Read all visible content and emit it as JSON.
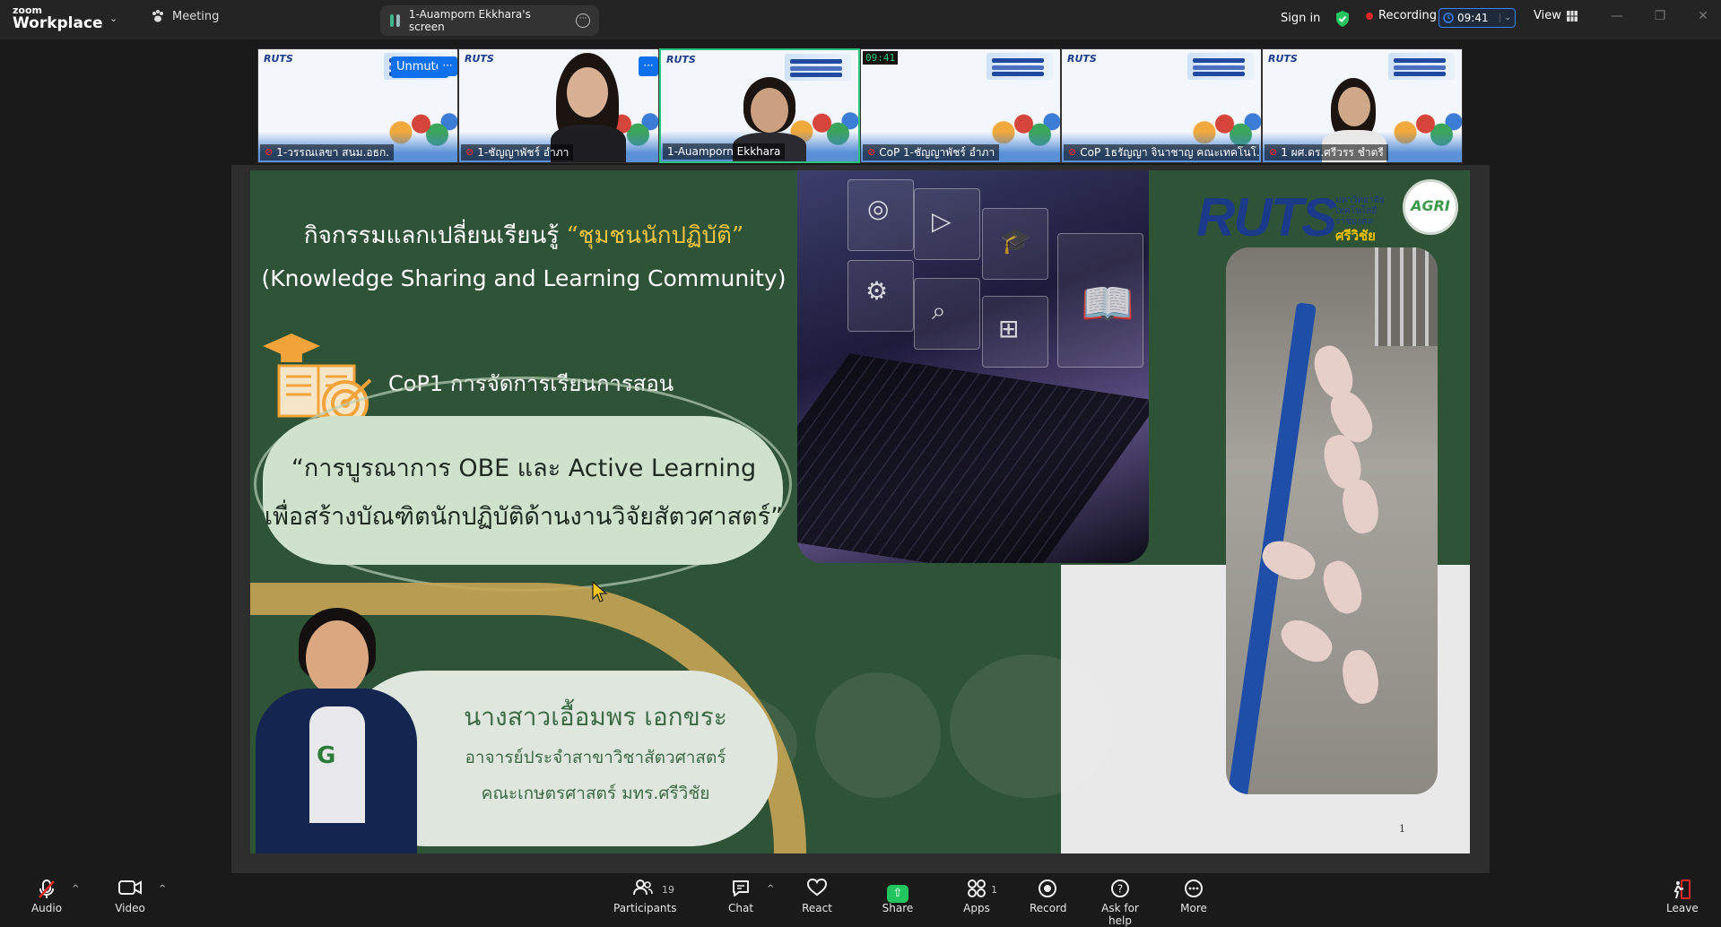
{
  "titlebar": {
    "brand_small": "zoom",
    "brand_large": "Workplace",
    "meeting_tab": "Meeting",
    "share_tab": "1-Auamporn Ekkhara's screen",
    "sign_in": "Sign in",
    "recording": "Recording",
    "timer": "09:41",
    "view": "View"
  },
  "filmstrip": {
    "tiles": [
      {
        "name": "1-วรรณเลขา  สนม.อธก.",
        "logo": "RUTS",
        "unmute": "Unmute",
        "muted": true
      },
      {
        "name": "1-ชัญญาพัชร์ อำภา",
        "logo": "RUTS",
        "muted": true
      },
      {
        "name": "1-Auamporn Ekkhara",
        "logo": "RUTS",
        "muted": false
      },
      {
        "name": "CoP 1-ชัญญาพัชร์ อำภา",
        "logo": "",
        "timer": "09:41",
        "muted": true
      },
      {
        "name": "CoP 1ธรัญญา จินาชาญ คณะเทคโนโ...",
        "logo": "RUTS",
        "muted": true
      },
      {
        "name": "1 ผศ.ดร.ศรีวรร ชำตรี",
        "logo": "RUTS",
        "muted": true
      }
    ]
  },
  "slide": {
    "title_thai_prefix": "กิจกรรมแลกเปลี่ยนเรียนรู้ ",
    "title_thai_highlight": "“ชุมชนนักปฏิบัติ”",
    "title_en": "(Knowledge Sharing and Learning Community)",
    "cop_line": "CoP1 การจัดการเรียนการสอน",
    "quote_line1": "“การบูรณาการ OBE และ Active Learning",
    "quote_line2": "เพื่อสร้างบัณฑิตนักปฏิบัติด้านงานวิจัยสัตวศาสตร์”",
    "logo_ruts": "RUTS",
    "logo_ruts_sub": "มหาวิทยาลัยเทคโนโลยีราชมงคล",
    "logo_ruts_campus": "ศรีวิชัย",
    "logo_agri": "AGRI",
    "speaker_name": "นางสาวเอื้อมพร เอกขระ",
    "speaker_role1": "อาจารย์ประจำสาขาวิชาสัตวศาสตร์",
    "speaker_role2": "คณะเกษตรศาสตร์ มทร.ศรีวิชัย",
    "page_number": "1"
  },
  "toolbar": {
    "audio": "Audio",
    "video": "Video",
    "participants": "Participants",
    "participants_count": "19",
    "chat": "Chat",
    "react": "React",
    "share": "Share",
    "apps": "Apps",
    "apps_count": "1",
    "record": "Record",
    "help": "Ask for help",
    "more": "More",
    "leave": "Leave"
  },
  "colors": {
    "slide_green": "#2f5336",
    "accent_gold": "#f5c542",
    "zoom_blue": "#0e71eb",
    "share_green": "#22c55e",
    "danger_red": "#e02828"
  }
}
